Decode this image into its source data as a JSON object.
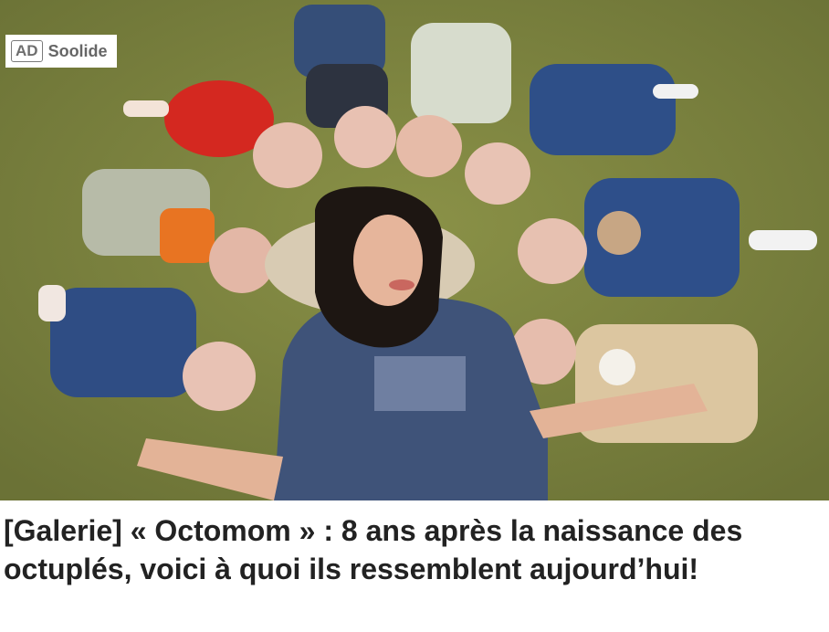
{
  "ad": {
    "tag": "AD",
    "source": "Soolide"
  },
  "headline": "[Galerie] « Octomom » : 8 ans après la naissance des octuplés, voici à quoi ils ressemblent aujourd’hui!",
  "photo": {
    "subject": "mother-with-octuplets"
  },
  "colors": {
    "carpet": "#79813e",
    "headline_text": "#222222",
    "badge_text": "#666666"
  }
}
